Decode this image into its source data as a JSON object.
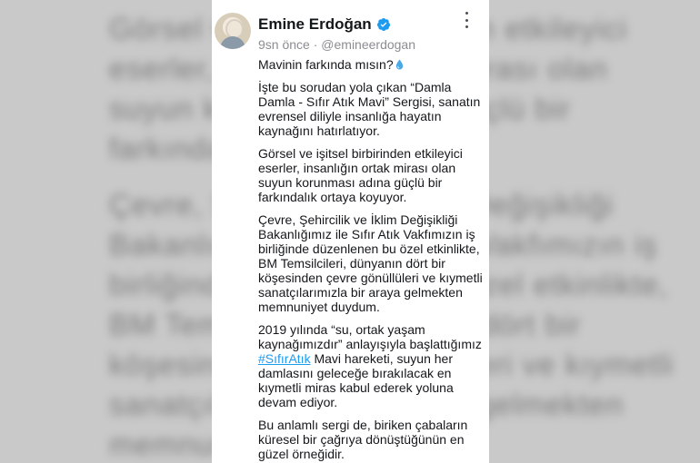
{
  "background": {
    "ghost_lines": [
      "Görsel ve işitsel birbirinden etkileyici",
      "eserler, insanlığın ortak mirası olan",
      "suyun korunması adına güçlü bir",
      "farkındalık ortaya koyuyor.",
      "Çevre, Şehircilik ve İklim Değişikliği",
      "Bakanlığımız ile Sıfır Atık Vakfımızın iş",
      "birliğinde düzenlenen bu özel etkinlikte,",
      "BM Temsilcileri, dünyanın dört bir",
      "köşesinden çevre gönüllüleri ve kıymetli",
      "sanatçılarımızla bir araya gelmekten",
      "memnuniyet duydum."
    ]
  },
  "tweet": {
    "author_name": "Emine Erdoğan",
    "time": "9sn önce",
    "separator": " · ",
    "handle": "@emineerdogan",
    "paragraph_1": "Mavinin farkında mısın?",
    "paragraph_2": "İşte bu sorudan yola çıkan “Damla Damla - Sıfır Atık Mavi” Sergisi, sanatın evrensel diliyle insanlığa hayatın kaynağını hatırlatıyor.",
    "paragraph_3": "Görsel ve işitsel birbirinden etkileyici eserler, insanlığın ortak mirası olan suyun korunması adına güçlü bir farkındalık ortaya koyuyor.",
    "paragraph_4": "Çevre, Şehircilik ve İklim Değişikliği Bakanlığımız ile Sıfır Atık Vakfımızın iş birliğinde düzenlenen bu özel etkinlikte, BM Temsilcileri, dünyanın dört bir köşesinden çevre gönüllüleri ve kıymetli sanatçılarımızla bir araya gelmekten memnuniyet duydum.",
    "paragraph_5_before": "2019 yılında “su, ortak yaşam kaynağımızdır” anlayışıyla başlattığımız ",
    "hashtag": "#SıfırAtık",
    "paragraph_5_after": " Mavi hareketi, suyun her damlasını geleceğe bırakılacak en kıymetli miras kabul ederek yoluna devam ediyor.",
    "paragraph_6": "Bu anlamlı sergi de, biriken çabaların küresel bir çağrıya dönüştüğünün en güzel örneğidir."
  },
  "icons": {
    "verified": "verified-badge-icon",
    "droplet": "droplet-emoji-icon",
    "more": "more-options-icon"
  },
  "colors": {
    "link": "#1d9bf0",
    "verified": "#1d9bf0",
    "text": "#14171a",
    "meta": "#8a8d91"
  }
}
